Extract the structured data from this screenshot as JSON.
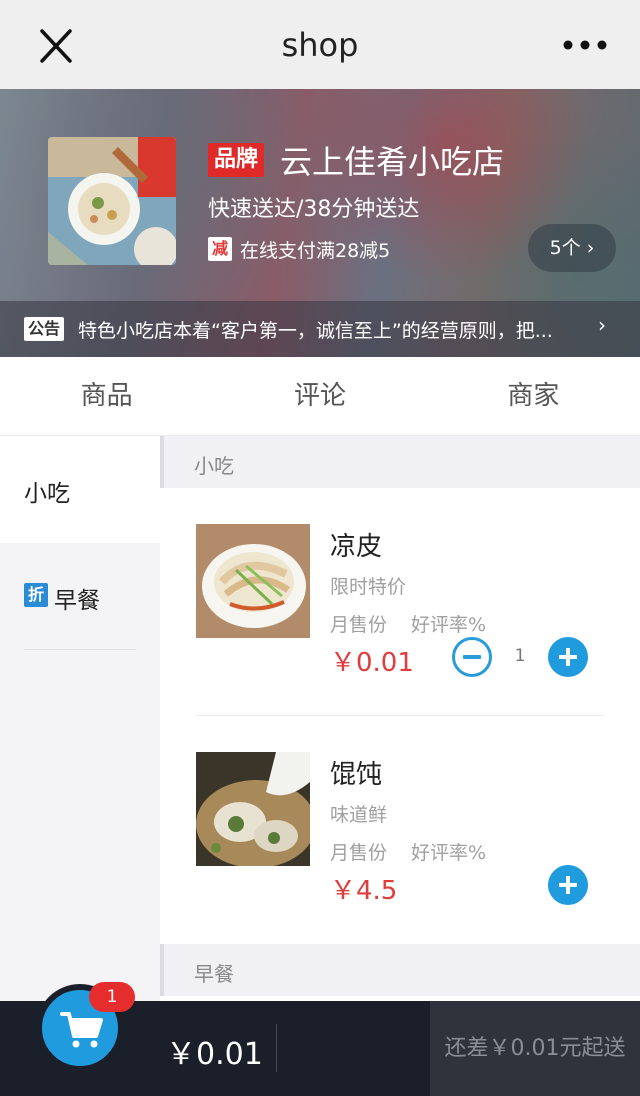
{
  "nav": {
    "title": "shop"
  },
  "shop": {
    "brand_badge": "品牌",
    "name": "云上佳肴小吃店",
    "delivery": "快速送达/38分钟送达",
    "promo_icon": "减",
    "promo_text": "在线支付满28减5",
    "promo_count": "5个 ›",
    "notice_tag": "公告",
    "notice_text": "特色小吃店本着“客户第一，诚信至上”的经营原则，把...",
    "notice_arrow": "›"
  },
  "tabs": [
    {
      "label": "商品"
    },
    {
      "label": "评论"
    },
    {
      "label": "商家"
    }
  ],
  "sidebar": {
    "items": [
      {
        "label": "小吃"
      },
      {
        "badge": "折",
        "label": "早餐"
      }
    ]
  },
  "content": {
    "categories": [
      {
        "title": "小吃",
        "products": [
          {
            "name": "凉皮",
            "desc": "限时特价",
            "monthly_sales": "月售份",
            "rating": "好评率%",
            "price": "￥0.01",
            "quantity": "1"
          },
          {
            "name": "馄饨",
            "desc": "味道鲜",
            "monthly_sales": "月售份",
            "rating": "好评率%",
            "price": "￥4.5"
          }
        ]
      },
      {
        "title": "早餐"
      }
    ]
  },
  "cart": {
    "badge_count": "1",
    "total": "￥0.01",
    "min_order_text": "还差￥0.01元起送"
  },
  "colors": {
    "accent": "#1f9bde",
    "price": "#e23b3b",
    "badge_red": "#e02a2a",
    "cart_bar": "#1b1f29"
  },
  "icons": [
    "close-icon",
    "more-icon",
    "cart-icon",
    "minus-icon",
    "plus-icon"
  ]
}
